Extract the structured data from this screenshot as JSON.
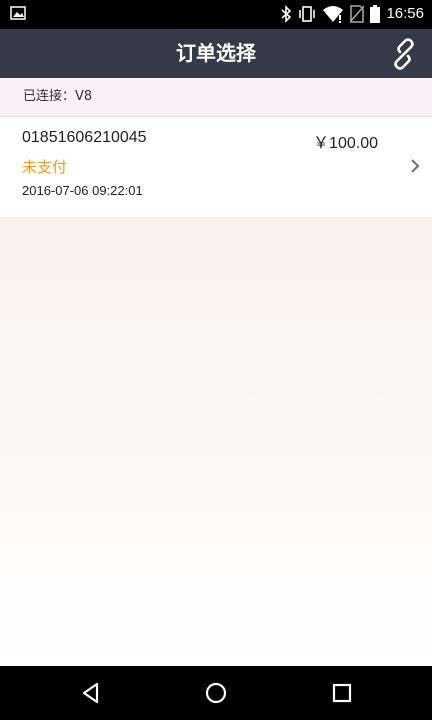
{
  "status_bar": {
    "time": "16:56",
    "icons": [
      "image-icon",
      "bluetooth-icon",
      "vibrate-icon",
      "wifi-icon",
      "no-sim-icon",
      "battery-icon"
    ]
  },
  "header": {
    "title": "订单选择",
    "link_icon": "link-icon"
  },
  "connection": {
    "text": "已连接：V8"
  },
  "orders": [
    {
      "number": "01851606210045",
      "amount": "￥100.00",
      "status": "未支付",
      "time": "2016-07-06 09:22:01"
    }
  ],
  "nav": {
    "back_icon": "back-icon",
    "home_icon": "home-icon",
    "recents_icon": "recents-icon"
  },
  "colors": {
    "header_bg": "#343a48",
    "status_unpaid": "#f39a1f",
    "connection_bg": "#fbf0f5"
  }
}
